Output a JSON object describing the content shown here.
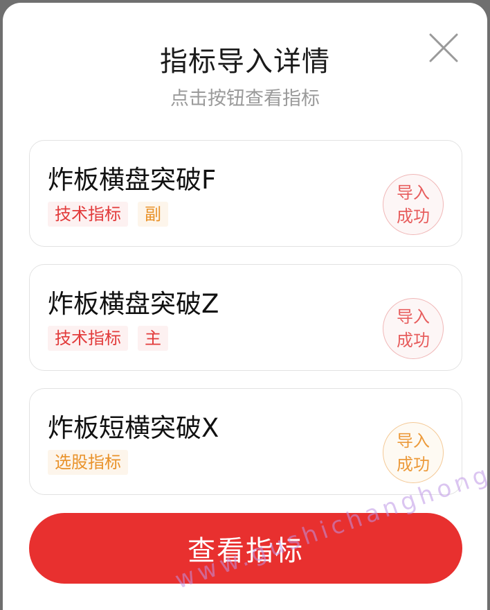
{
  "modal": {
    "title": "指标导入详情",
    "subtitle": "点击按钮查看指标"
  },
  "indicators": [
    {
      "name": "炸板横盘突破F",
      "tags": [
        "技术指标",
        "副"
      ],
      "status_line1": "导入",
      "status_line2": "成功"
    },
    {
      "name": "炸板横盘突破Z",
      "tags": [
        "技术指标",
        "主"
      ],
      "status_line1": "导入",
      "status_line2": "成功"
    },
    {
      "name": "炸板短横突破X",
      "tags": [
        "选股指标"
      ],
      "status_line1": "导入",
      "status_line2": "成功"
    }
  ],
  "action_button": {
    "label": "查看指标"
  },
  "watermark": "www.gushichanghong.com",
  "colors": {
    "accent_red": "#e8302f",
    "tag_red": "#e23b3b",
    "tag_orange": "#e9922a"
  },
  "icons": {
    "close": "close-icon"
  }
}
